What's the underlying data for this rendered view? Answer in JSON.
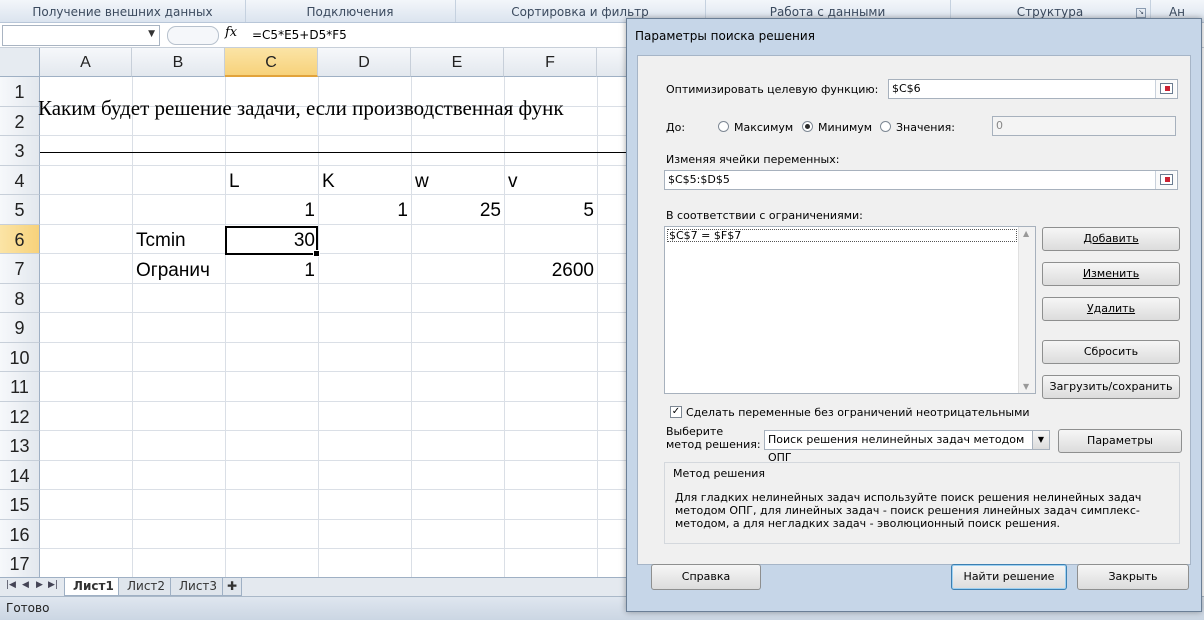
{
  "ribbon": {
    "groups": [
      "Получение внешних данных",
      "Подключения",
      "Сортировка и фильтр",
      "Работа с данными",
      "Структура",
      "Ан"
    ]
  },
  "formula_bar": {
    "name_box": "",
    "fx_label": "fx",
    "formula": "=C5*E5+D5*F5"
  },
  "sheet": {
    "columns": [
      "A",
      "B",
      "C",
      "D",
      "E",
      "F"
    ],
    "rows": [
      "1",
      "2",
      "3",
      "4",
      "5",
      "6",
      "7",
      "8",
      "9",
      "10",
      "11",
      "12",
      "13",
      "14",
      "15",
      "16",
      "17"
    ],
    "headline": "Каким будет решение задачи, если производственная функ",
    "labels": {
      "L": "L",
      "K": "K",
      "w": "w",
      "v": "v"
    },
    "values": {
      "C5": "1",
      "D5": "1",
      "E5": "25",
      "F5": "5",
      "C6": "30",
      "C7": "1",
      "F7": "2600"
    },
    "row_labels": {
      "B6": "Tcmin",
      "B7": "Огранич"
    },
    "selected_cell": "C6"
  },
  "sheet_tabs": [
    "Лист1",
    "Лист2",
    "Лист3"
  ],
  "status": "Готово",
  "dialog": {
    "title": "Параметры поиска решения",
    "objective_label": "Оптимизировать целевую функцию:",
    "objective_value": "$C$6",
    "to_label": "До:",
    "radio_max": "Максимум",
    "radio_min": "Минимум",
    "radio_value": "Значения:",
    "value_field": "0",
    "vars_label": "Изменяя ячейки переменных:",
    "vars_value": "$C$5:$D$5",
    "constraints_label": "В соответствии с ограничениями:",
    "constraints": [
      "$C$7 = $F$7"
    ],
    "btn_add": "Добавить",
    "btn_change": "Изменить",
    "btn_delete": "Удалить",
    "btn_reset": "Сбросить",
    "btn_load_save": "Загрузить/сохранить",
    "nonneg_label": "Сделать переменные без ограничений неотрицательными",
    "method_label_1": "Выберите",
    "method_label_2": "метод решения:",
    "method_value": "Поиск решения нелинейных задач методом ОПГ",
    "btn_params": "Параметры",
    "method_group_title": "Метод решения",
    "method_desc": "Для гладких нелинейных задач используйте поиск решения нелинейных задач методом ОПГ, для линейных задач - поиск решения линейных задач симплекс-методом, а для негладких задач - эволюционный поиск решения.",
    "btn_help": "Справка",
    "btn_solve": "Найти решение",
    "btn_close": "Закрыть"
  }
}
